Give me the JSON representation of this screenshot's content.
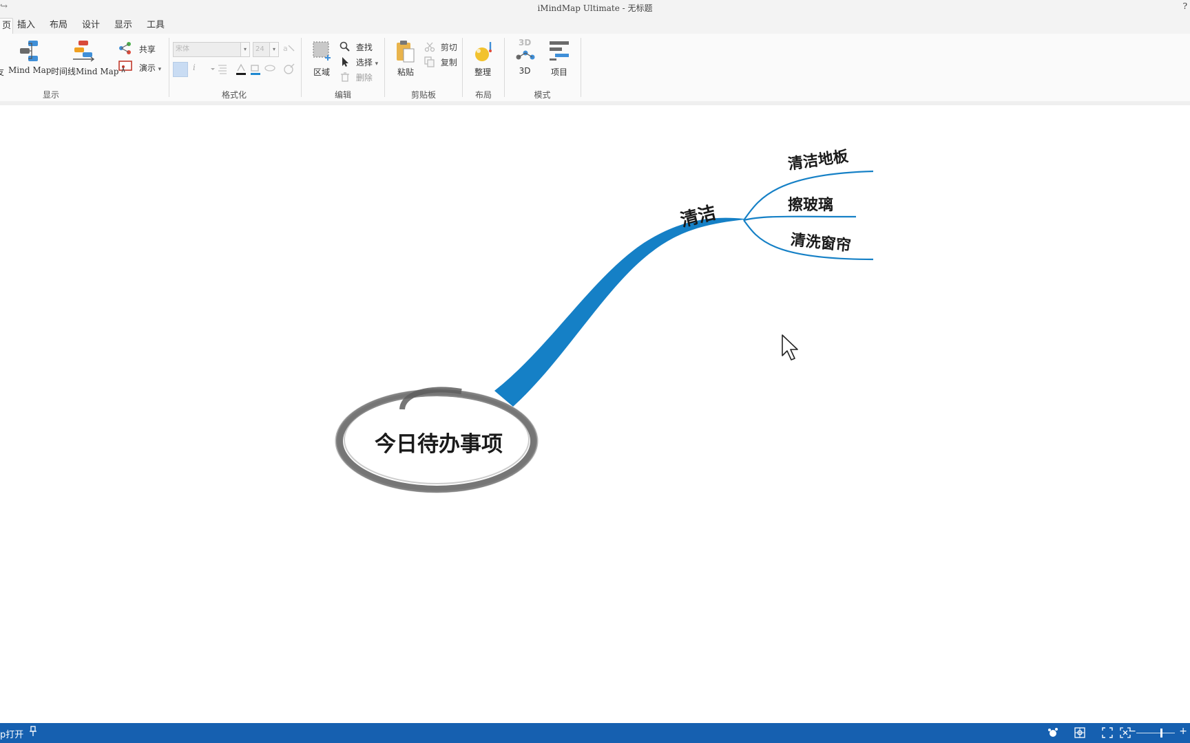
{
  "window": {
    "title": "iMindMap Ultimate - 无标题",
    "help": "?",
    "qat_icon": "redo-arrow-icon"
  },
  "tabs": [
    {
      "label": "页",
      "active": true
    },
    {
      "label": "插入"
    },
    {
      "label": "布局"
    },
    {
      "label": "设计"
    },
    {
      "label": "显示"
    },
    {
      "label": "工具"
    }
  ],
  "ribbon": {
    "display_group": {
      "label": "显示",
      "cut_off_label": "友",
      "mindmap_label": "Mind Map",
      "timeline_label": "时间线",
      "timeline_mindmap_label": "Mind Map",
      "share_label": "共享",
      "present_label": "演示"
    },
    "format_group": {
      "label": "格式化",
      "font_value": "宋体",
      "size_value": "24"
    },
    "edit_group": {
      "label": "编辑",
      "region_label": "区域",
      "find_label": "查找",
      "select_label": "选择",
      "delete_label": "删除"
    },
    "clipboard_group": {
      "label": "剪贴板",
      "paste_label": "粘贴",
      "cut_label": "剪切",
      "copy_label": "复制"
    },
    "layout_group": {
      "label": "布局",
      "arrange_label": "整理"
    },
    "mode_group": {
      "label": "模式",
      "three_d_label": "3D",
      "project_label": "项目"
    }
  },
  "mindmap": {
    "central_topic": "今日待办事项",
    "branch": {
      "label": "清洁",
      "color": "#1580c6",
      "children": [
        "清洁地板",
        "擦玻璃",
        "清洗窗帘"
      ]
    },
    "ring_color": "#6e6e6e"
  },
  "statusbar": {
    "left_text": "p打开",
    "pin_icon": "pin-icon",
    "background": "#1660b0"
  }
}
